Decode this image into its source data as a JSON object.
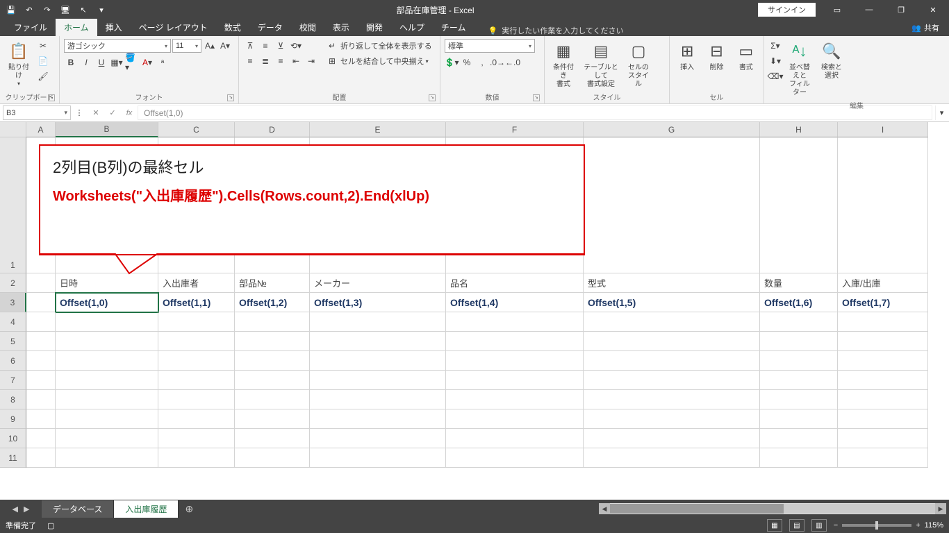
{
  "app": {
    "title": "部品在庫管理 - Excel",
    "signin": "サインイン",
    "share": "共有"
  },
  "qat": {
    "save": "💾",
    "undo": "↶",
    "redo": "↷",
    "touch": "🖥",
    "pointer": "↖",
    "more": "▾"
  },
  "tabs": {
    "file": "ファイル",
    "home": "ホーム",
    "insert": "挿入",
    "layout": "ページ レイアウト",
    "formulas": "数式",
    "data": "データ",
    "review": "校閲",
    "view": "表示",
    "dev": "開発",
    "help": "ヘルプ",
    "team": "チーム",
    "tellme": "実行したい作業を入力してください"
  },
  "ribbon": {
    "clipboard": {
      "paste": "貼り付け",
      "label": "クリップボード"
    },
    "font": {
      "name": "游ゴシック",
      "size": "11",
      "label": "フォント",
      "b": "B",
      "i": "I",
      "u": "U"
    },
    "align": {
      "wrap": "折り返して全体を表示する",
      "merge": "セルを結合して中央揃え",
      "label": "配置"
    },
    "number": {
      "fmt": "標準",
      "label": "数値"
    },
    "styles": {
      "cond": "条件付き\n書式",
      "table": "テーブルとして\n書式設定",
      "cell": "セルの\nスタイル",
      "label": "スタイル"
    },
    "cells": {
      "insert": "挿入",
      "delete": "削除",
      "format": "書式",
      "label": "セル"
    },
    "editing": {
      "sort": "並べ替えと\nフィルター",
      "find": "検索と\n選択",
      "label": "編集"
    }
  },
  "formula": {
    "namebox": "B3",
    "fx": "Offset(1,0)"
  },
  "cols": [
    "A",
    "B",
    "C",
    "D",
    "E",
    "F",
    "G",
    "H",
    "I"
  ],
  "rownums": [
    "1",
    "2",
    "3",
    "4",
    "5",
    "6",
    "7",
    "8",
    "9",
    "10",
    "11"
  ],
  "headers": {
    "b": "日時",
    "c": "入出庫者",
    "d": "部品№",
    "e": "メーカー",
    "f": "品名",
    "g": "型式",
    "h": "数量",
    "i": "入庫/出庫"
  },
  "data3": {
    "b": "Offset(1,0)",
    "c": "Offset(1,1)",
    "d": "Offset(1,2)",
    "e": "Offset(1,3)",
    "f": "Offset(1,4)",
    "g": "Offset(1,5)",
    "h": "Offset(1,6)",
    "i": "Offset(1,7)"
  },
  "callout": {
    "line1": "2列目(B列)の最終セル",
    "line2": "Worksheets(\"入出庫履歴\").Cells(Rows.count,2).End(xlUp)"
  },
  "sheets": {
    "s1": "データベース",
    "s2": "入出庫履歴"
  },
  "status": {
    "ready": "準備完了",
    "zoom": "115%"
  }
}
